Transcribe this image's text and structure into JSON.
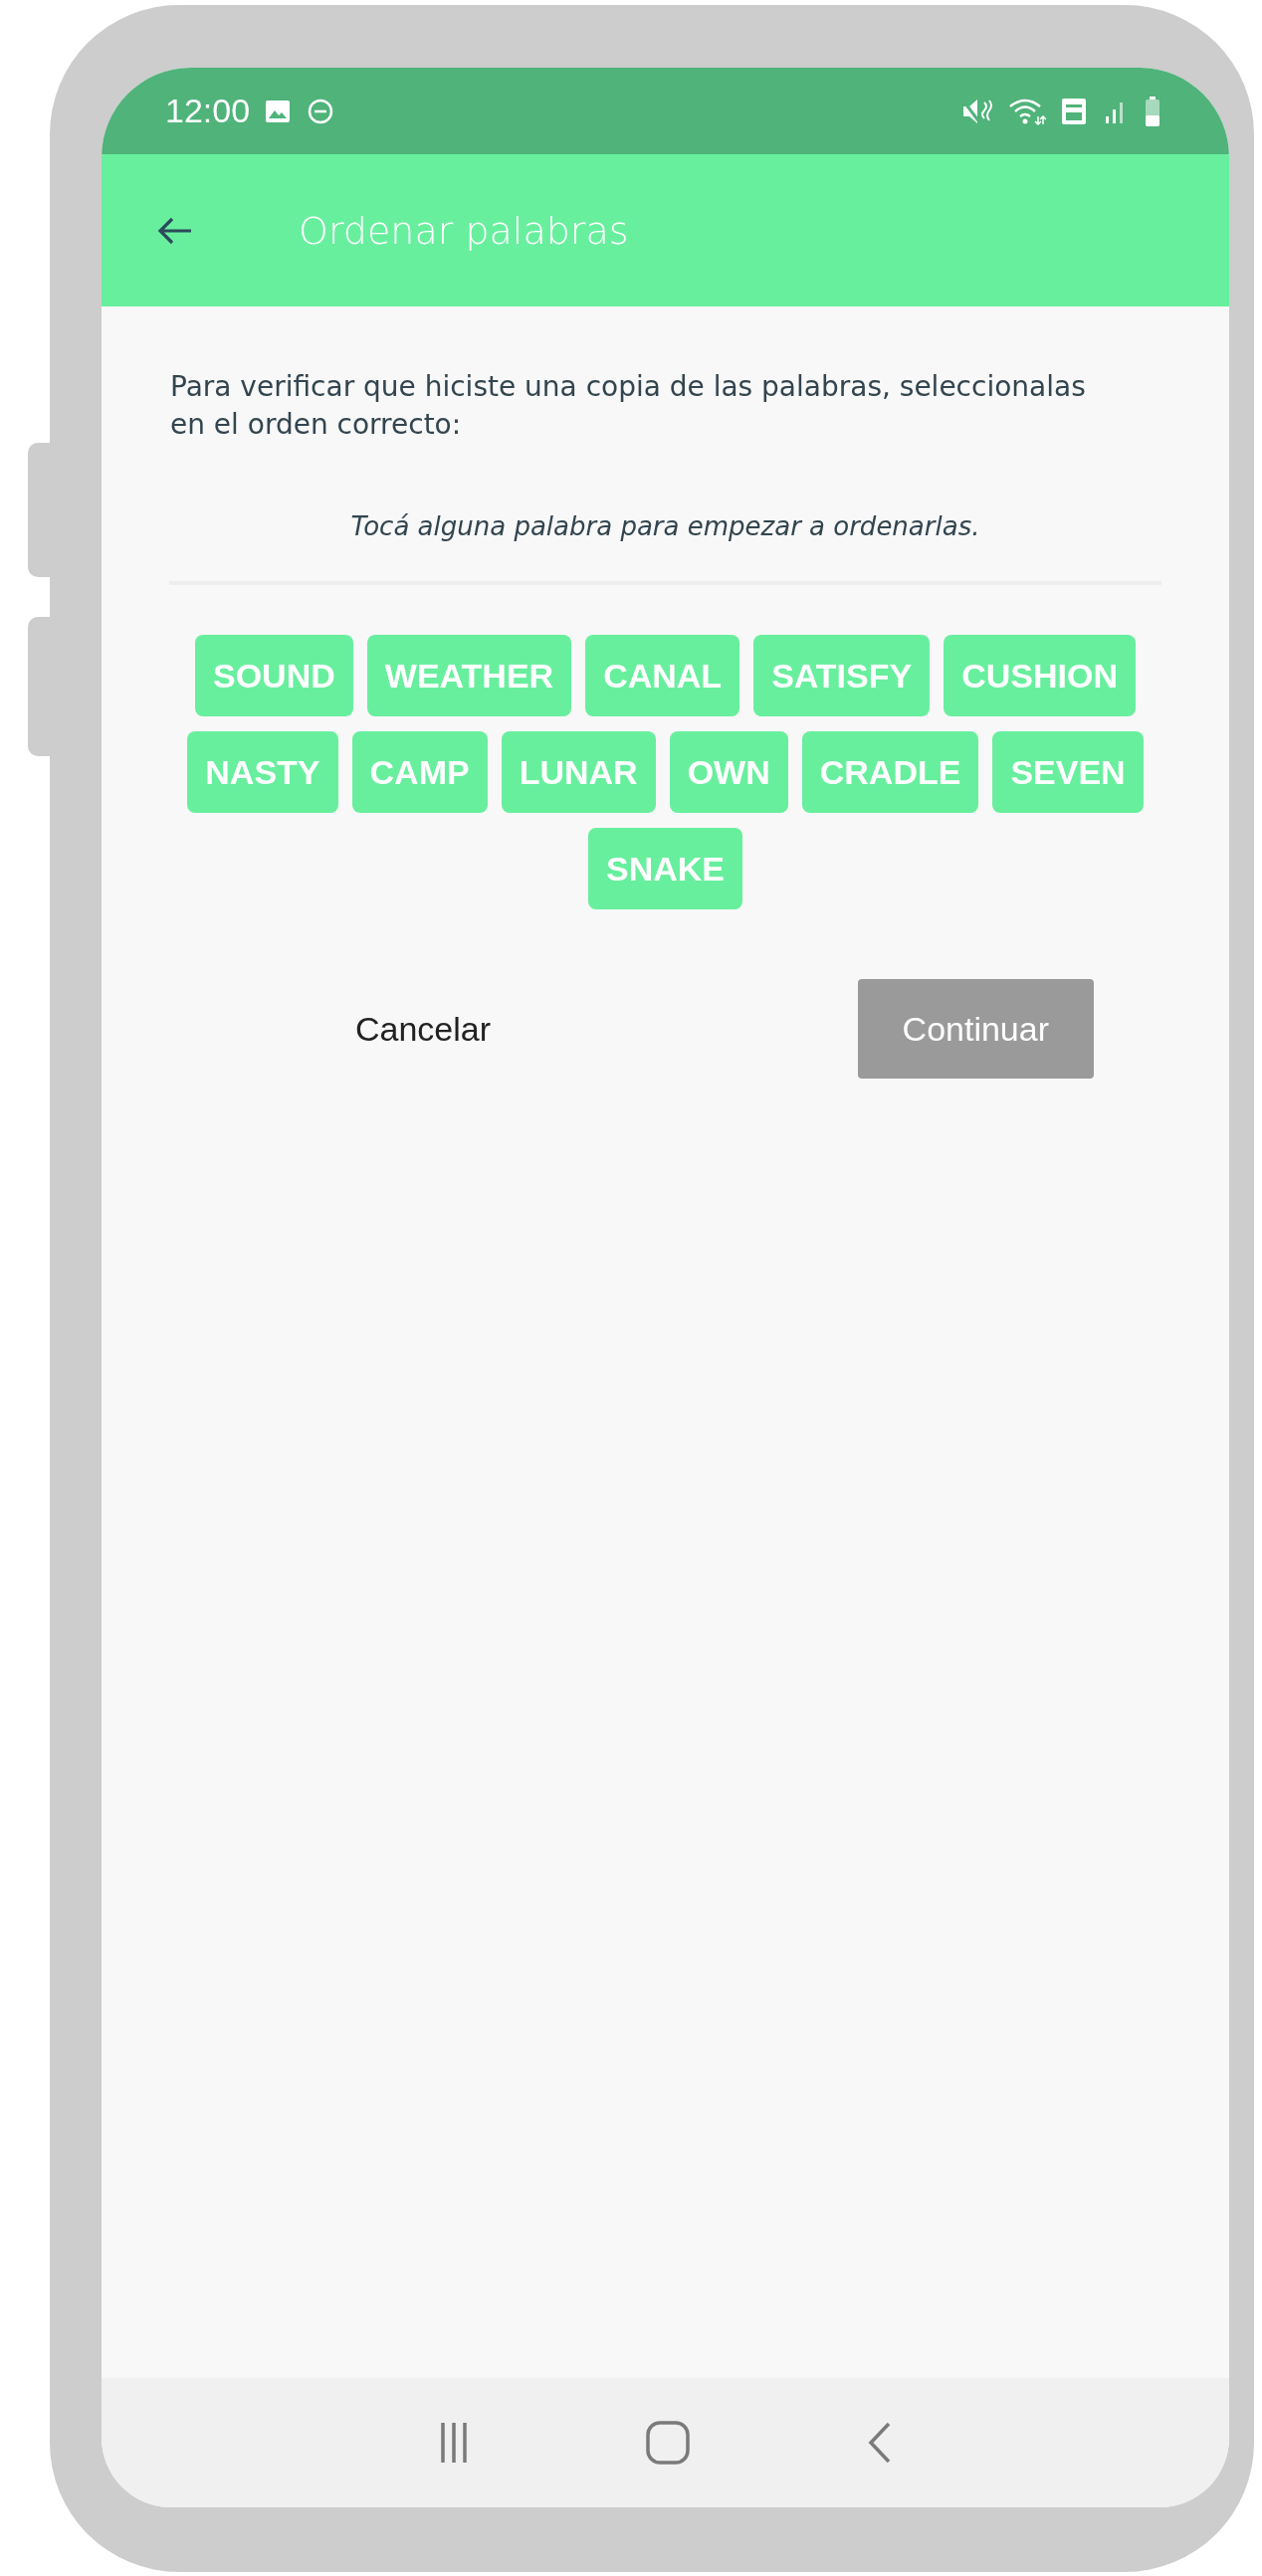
{
  "status_bar": {
    "time": "12:00"
  },
  "app_bar": {
    "title": "Ordenar palabras"
  },
  "instruction": "Para verificar que hiciste una copia de las palabras, seleccionalas en el orden correcto:",
  "hint": "Tocá alguna palabra para empezar a ordenarlas.",
  "words": [
    "SOUND",
    "WEATHER",
    "CANAL",
    "SATISFY",
    "CUSHION",
    "NASTY",
    "CAMP",
    "LUNAR",
    "OWN",
    "CRADLE",
    "SEVEN",
    "SNAKE"
  ],
  "buttons": [
    {
      "label": "Cancelar",
      "kind": "text",
      "disabled": false
    },
    {
      "label": "Continuar",
      "kind": "filled",
      "disabled": true
    }
  ]
}
